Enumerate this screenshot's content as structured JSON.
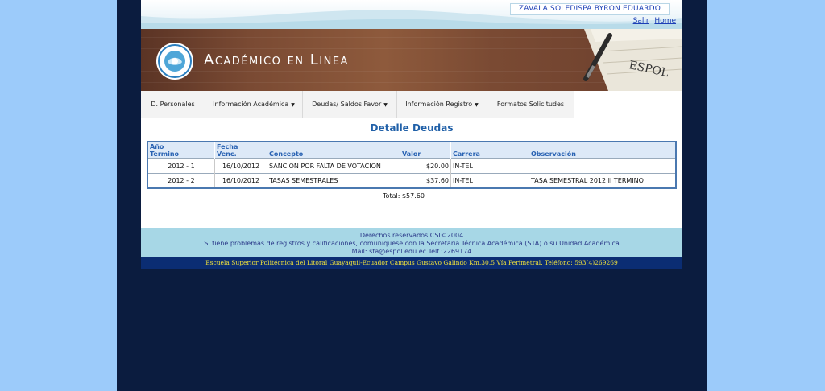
{
  "header": {
    "user_name": "ZAVALA SOLEDISPA BYRON EDUARDO",
    "links": {
      "exit": "Salir",
      "home": "Home"
    },
    "banner_title": "Académico en Linea",
    "notebook_text": "ESPOL"
  },
  "menu": {
    "items": [
      {
        "label": "D. Personales"
      },
      {
        "label": "Información Académica"
      },
      {
        "label": "Deudas/ Saldos Favor"
      },
      {
        "label": "Información Registro"
      },
      {
        "label": "Formatos Solicitudes"
      }
    ]
  },
  "main": {
    "title": "Detalle Deudas",
    "columns": {
      "anio_termino": [
        "Año",
        "Termino"
      ],
      "fecha_venc": [
        "Fecha",
        "Venc."
      ],
      "concepto": "Concepto",
      "valor": "Valor",
      "carrera": "Carrera",
      "observacion": "Observación"
    },
    "rows": [
      {
        "termino": "2012 - 1",
        "fecha": "16/10/2012",
        "concepto": "SANCION POR FALTA DE VOTACION",
        "valor": "$20.00",
        "carrera": "IN-TEL",
        "observacion": ""
      },
      {
        "termino": "2012 - 2",
        "fecha": "16/10/2012",
        "concepto": "TASAS SEMESTRALES",
        "valor": "$37.60",
        "carrera": "IN-TEL",
        "observacion": "TASA SEMESTRAL 2012 II TÉRMINO"
      }
    ],
    "total": "Total: $57.60"
  },
  "footer": {
    "line1": "Derechos reservados CSI©2004",
    "line2": "Si tiene problemas de registros y calificaciones, comuniquese con la Secretaria Técnica Académica (STA) o su Unidad Académica",
    "line3": "Mail: sta@espol.edu.ec Telf.:2269174",
    "address": "Escuela Superior Politécnica del Litoral Guayaquil-Ecuador Campus Gustavo Galindo Km.30.5 Vía Perimetral. Teléfono: 593(4)269269"
  },
  "colors": {
    "page_bg": "#9ccbfa",
    "frame_bg": "#0b1c3f",
    "title_blue": "#2060a8",
    "footer_light": "#a7d7e6",
    "footer_dark": "#0b2d73",
    "footer_text_yellow": "#f2e33b"
  }
}
